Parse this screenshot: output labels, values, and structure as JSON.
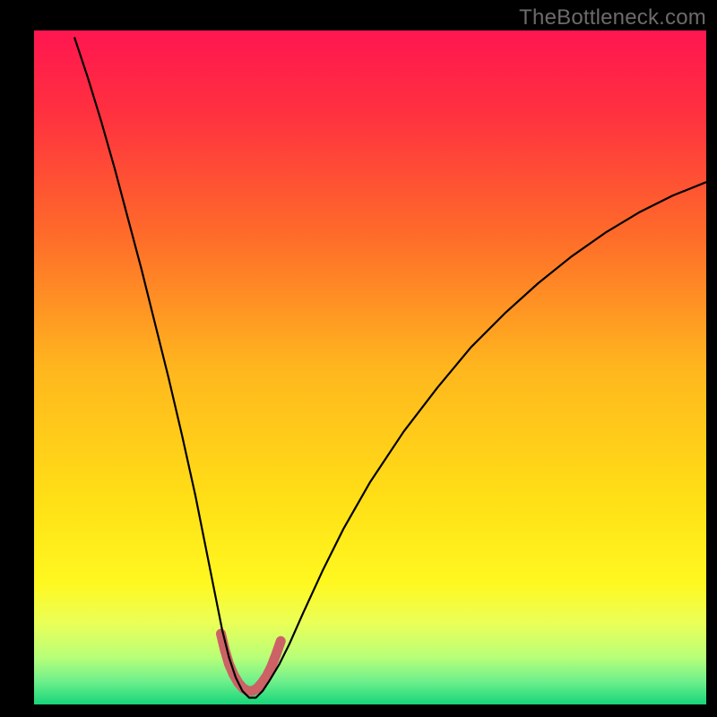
{
  "watermark": "TheBottleneck.com",
  "chart_data": {
    "type": "line",
    "title": "",
    "xlabel": "",
    "ylabel": "",
    "xlim": [
      0,
      100
    ],
    "ylim": [
      0,
      100
    ],
    "background_gradient": {
      "stops": [
        {
          "offset": 0.0,
          "color": "#ff1650"
        },
        {
          "offset": 0.12,
          "color": "#ff3040"
        },
        {
          "offset": 0.3,
          "color": "#ff6a2a"
        },
        {
          "offset": 0.5,
          "color": "#ffb61e"
        },
        {
          "offset": 0.7,
          "color": "#ffe016"
        },
        {
          "offset": 0.82,
          "color": "#fff820"
        },
        {
          "offset": 0.88,
          "color": "#eaff58"
        },
        {
          "offset": 0.93,
          "color": "#b8ff78"
        },
        {
          "offset": 0.965,
          "color": "#70f08c"
        },
        {
          "offset": 1.0,
          "color": "#18d67a"
        }
      ]
    },
    "series": [
      {
        "name": "bottleneck-curve",
        "color": "#000000",
        "width": 2.2,
        "x": [
          6.0,
          8.0,
          10.0,
          12.0,
          14.0,
          16.0,
          18.0,
          20.0,
          22.0,
          24.0,
          25.0,
          26.0,
          27.0,
          28.0,
          29.0,
          30.0,
          31.0,
          32.0,
          33.0,
          34.0,
          35.0,
          36.5,
          38.0,
          40.0,
          43.0,
          46.0,
          50.0,
          55.0,
          60.0,
          65.0,
          70.0,
          75.0,
          80.0,
          85.0,
          90.0,
          95.0,
          100.0
        ],
        "y": [
          99.0,
          93.0,
          86.5,
          79.5,
          72.0,
          64.5,
          56.5,
          48.5,
          40.0,
          31.0,
          26.0,
          21.0,
          16.0,
          11.0,
          7.0,
          4.0,
          2.0,
          1.0,
          1.0,
          2.0,
          3.5,
          6.0,
          9.0,
          13.5,
          20.0,
          26.0,
          33.0,
          40.5,
          47.0,
          53.0,
          58.0,
          62.5,
          66.5,
          70.0,
          73.0,
          75.5,
          77.5
        ]
      },
      {
        "name": "optimal-band-marker",
        "color": "#cc6166",
        "width": 11,
        "linecap": "round",
        "x": [
          27.8,
          28.4,
          29.0,
          29.7,
          30.4,
          31.1,
          31.8,
          32.5,
          33.2,
          33.9,
          34.6,
          35.3,
          36.0,
          36.7
        ],
        "y": [
          10.5,
          8.0,
          6.0,
          4.4,
          3.2,
          2.4,
          2.0,
          2.0,
          2.4,
          3.2,
          4.2,
          5.6,
          7.4,
          9.4
        ]
      }
    ]
  }
}
